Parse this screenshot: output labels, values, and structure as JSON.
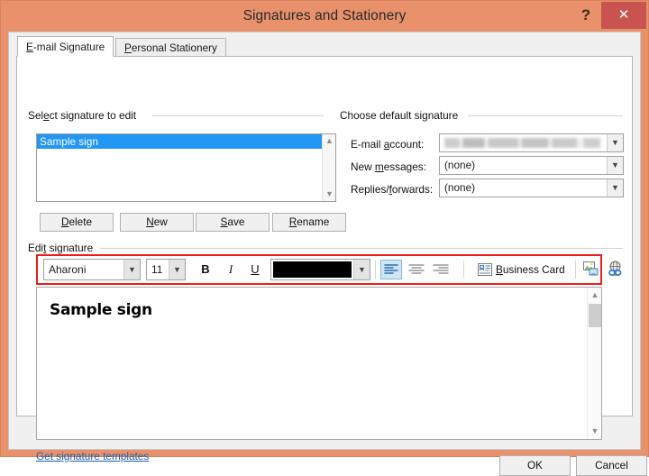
{
  "window": {
    "title": "Signatures and Stationery",
    "help_label": "?",
    "close_label": "✕",
    "titlebar_color": "#E8916A",
    "close_button_color": "#C9544F"
  },
  "tabs": [
    {
      "label": "E-mail Signature",
      "accel": "E",
      "active": true
    },
    {
      "label": "Personal Stationery",
      "accel": "P",
      "active": false
    }
  ],
  "select_signature_group": {
    "label": "Select signature to edit",
    "accel": "e",
    "list_items": [
      {
        "label": "Sample sign",
        "selected": true
      }
    ],
    "buttons": [
      {
        "label": "Delete",
        "accel": "D"
      },
      {
        "label": "New",
        "accel": "N"
      },
      {
        "label": "Save",
        "accel": "S"
      },
      {
        "label": "Rename",
        "accel": "R"
      }
    ]
  },
  "default_signature_group": {
    "label": "Choose default signature",
    "fields": [
      {
        "label": "E-mail account:",
        "accel": "a",
        "value": "",
        "redacted": true
      },
      {
        "label": "New messages:",
        "accel": "m",
        "value": "(none)",
        "redacted": false
      },
      {
        "label": "Replies/forwards:",
        "accel": "f",
        "value": "(none)",
        "redacted": false
      }
    ]
  },
  "edit_signature_group": {
    "label": "Edit signature",
    "accel": "t",
    "highlight_color": "#EE1C1C",
    "toolbar": {
      "font_name": "Aharoni",
      "font_size": "11",
      "bold_label": "B",
      "italic_label": "I",
      "underline_label": "U",
      "font_color": "#000000",
      "alignment": "left",
      "business_card_label": "Business Card",
      "business_card_accel": "B",
      "picture_icon": "insert-picture-icon",
      "hyperlink_icon": "insert-hyperlink-icon"
    },
    "body_text": "Sample sign"
  },
  "templates_link": {
    "label": "Get signature templates"
  },
  "footer": {
    "ok_label": "OK",
    "cancel_label": "Cancel"
  }
}
